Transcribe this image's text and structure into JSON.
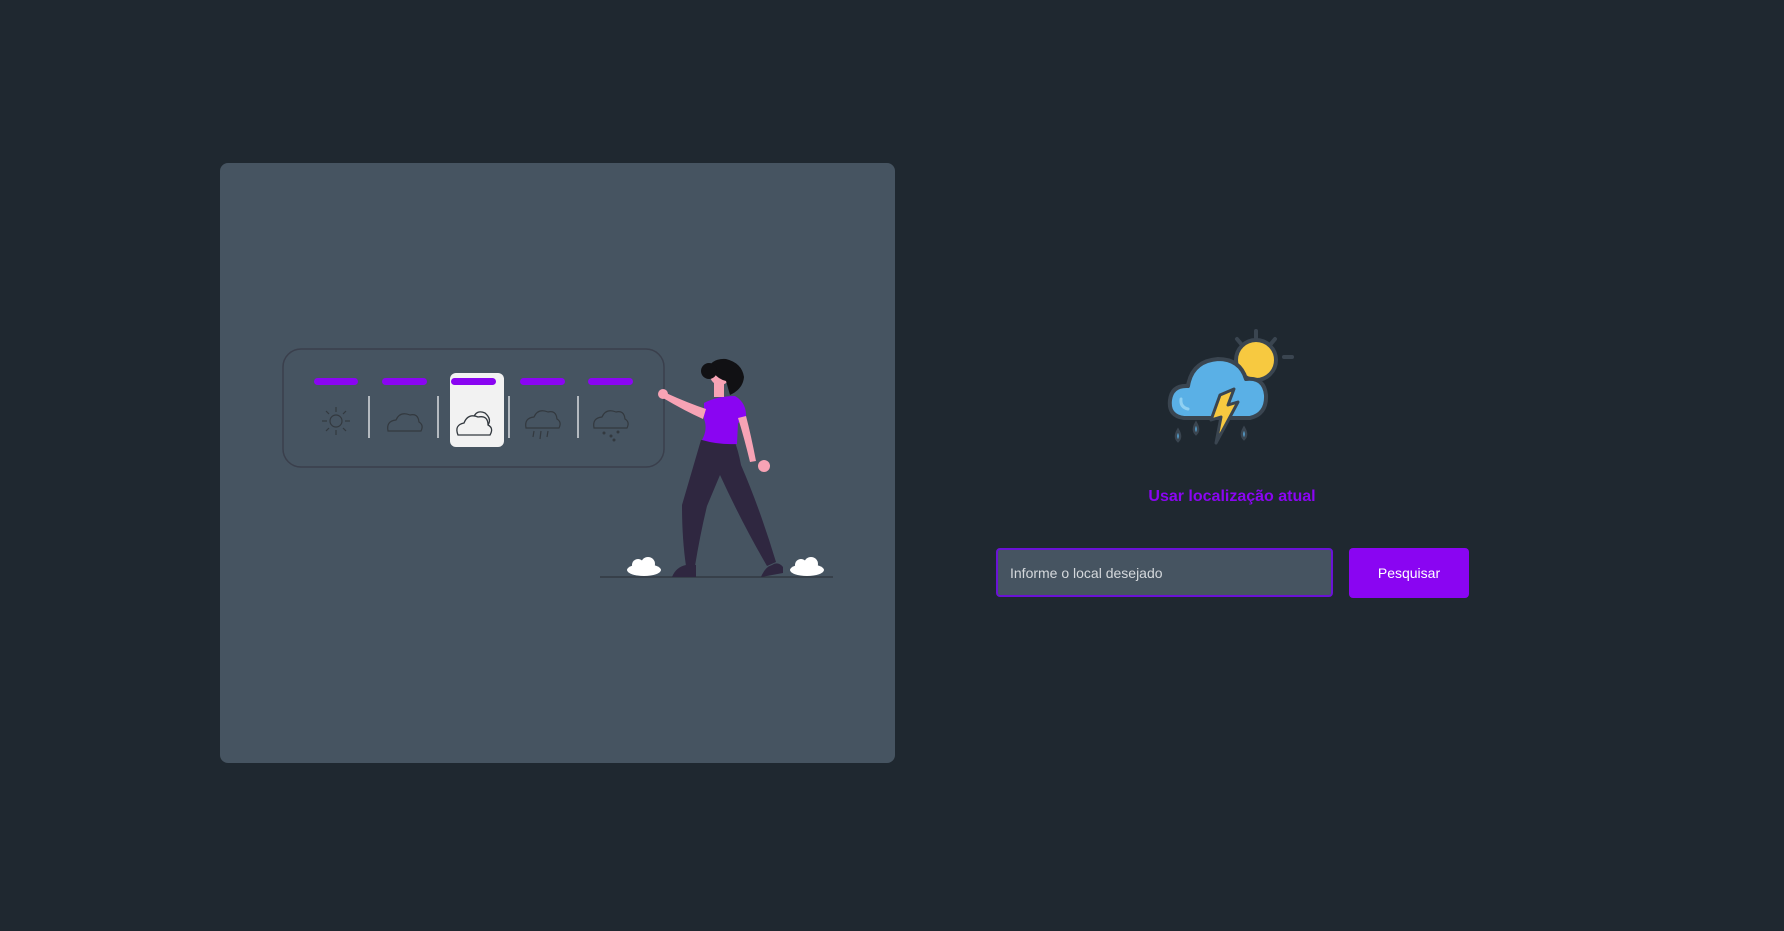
{
  "illustration": {
    "icons": [
      "sun-icon",
      "cloud-icon",
      "partly-cloudy-icon",
      "rain-icon",
      "snow-icon"
    ],
    "selected_index": 2
  },
  "logo": {
    "icon": "thunderstorm-weather-icon"
  },
  "location": {
    "label": "Usar localização atual"
  },
  "search": {
    "placeholder": "Informe o local desejado",
    "value": "",
    "button_label": "Pesquisar"
  },
  "colors": {
    "background": "#1f2830",
    "card": "#465461",
    "accent": "#8a05f2",
    "input_border": "#6a12d6",
    "cloud_blue": "#5ab0e6",
    "sun_yellow": "#f7c940",
    "person_shirt": "#8a05f2",
    "person_pants": "#2f2740",
    "person_skin": "#f7a3b5"
  }
}
